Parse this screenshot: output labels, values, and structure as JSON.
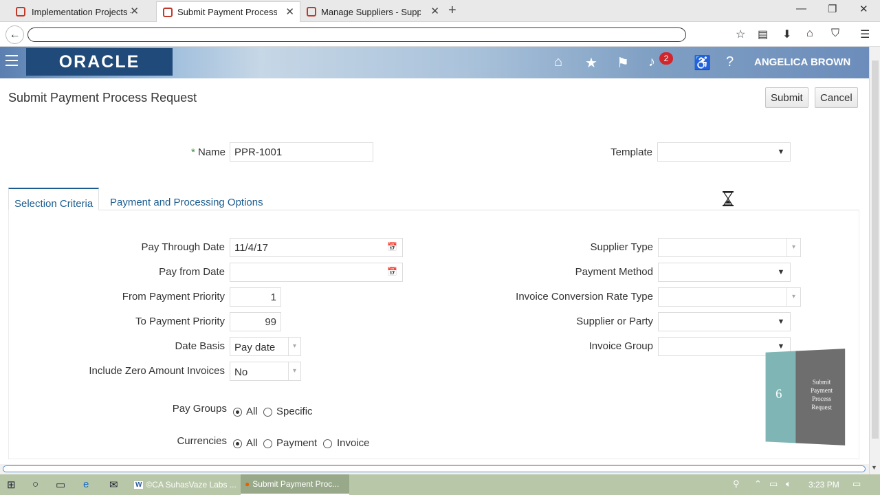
{
  "browser": {
    "tabs": [
      {
        "label": "Implementation Projects - ...",
        "active": false
      },
      {
        "label": "Submit Payment Process ...",
        "active": true
      },
      {
        "label": "Manage Suppliers - Suppl...",
        "active": false
      }
    ],
    "new_tab": "+",
    "address": ""
  },
  "header": {
    "logo": "ORACLE",
    "notification_count": "2",
    "user": "ANGELICA BROWN"
  },
  "page": {
    "title": "Submit Payment Process Request",
    "submit_label": "Submit",
    "cancel_label": "Cancel",
    "name_required_mark": "*",
    "name_label": "Name",
    "name_value": "PPR-1001",
    "template_label": "Template",
    "template_value": ""
  },
  "tabs": [
    {
      "label": "Selection Criteria",
      "active": true
    },
    {
      "label": "Payment and Processing Options",
      "active": false
    }
  ],
  "left_fields": {
    "pay_through_date_label": "Pay Through Date",
    "pay_through_date_value": "11/4/17",
    "pay_from_date_label": "Pay from Date",
    "pay_from_date_value": "",
    "from_priority_label": "From Payment Priority",
    "from_priority_value": "1",
    "to_priority_label": "To Payment Priority",
    "to_priority_value": "99",
    "date_basis_label": "Date Basis",
    "date_basis_value": "Pay date",
    "include_zero_label": "Include Zero Amount Invoices",
    "include_zero_value": "No"
  },
  "right_fields": {
    "supplier_type_label": "Supplier Type",
    "payment_method_label": "Payment Method",
    "conversion_rate_label": "Invoice Conversion Rate Type",
    "supplier_party_label": "Supplier or Party",
    "invoice_group_label": "Invoice Group"
  },
  "pay_groups": {
    "label": "Pay Groups",
    "options": [
      {
        "label": "All",
        "selected": true
      },
      {
        "label": "Specific",
        "selected": false
      }
    ]
  },
  "currencies": {
    "label": "Currencies",
    "options": [
      {
        "label": "All",
        "selected": true
      },
      {
        "label": "Payment",
        "selected": false
      },
      {
        "label": "Invoice",
        "selected": false
      }
    ]
  },
  "thumbnail": {
    "number": "6",
    "title": "Submit Payment Process Request"
  },
  "taskbar": {
    "apps": [
      {
        "label": "©CA SuhasVaze Labs ...",
        "active": false
      },
      {
        "label": "Submit Payment Proc...",
        "active": true
      }
    ],
    "clock": "3:23 PM"
  }
}
